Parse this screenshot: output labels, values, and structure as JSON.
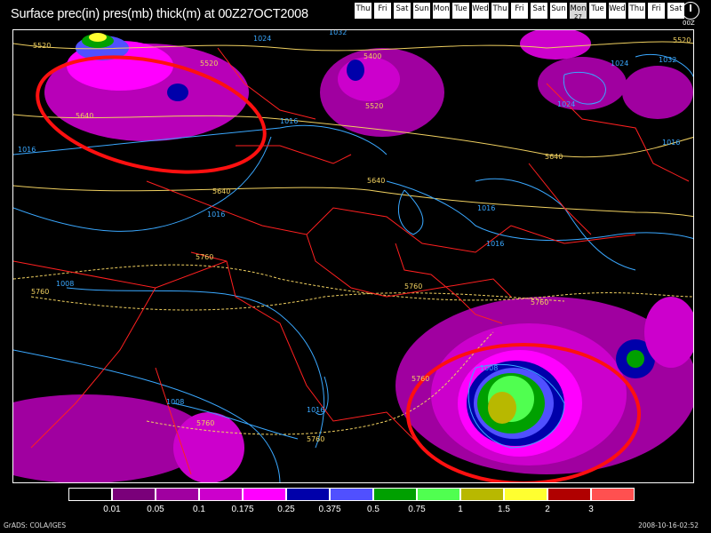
{
  "title": "Surface prec(in) pres(mb) thick(m) at 00Z27OCT2008",
  "days": [
    {
      "label": "Thu",
      "active": false
    },
    {
      "label": "Fri",
      "active": false
    },
    {
      "label": "Sat",
      "active": false
    },
    {
      "label": "Sun",
      "active": false
    },
    {
      "label": "Mon",
      "active": false
    },
    {
      "label": "Tue",
      "active": false
    },
    {
      "label": "Wed",
      "active": false
    },
    {
      "label": "Thu",
      "active": false
    },
    {
      "label": "Fri",
      "active": false
    },
    {
      "label": "Sat",
      "active": false
    },
    {
      "label": "Sun",
      "active": false
    },
    {
      "label": "Mon",
      "active": true,
      "date": "27"
    },
    {
      "label": "Tue",
      "active": false
    },
    {
      "label": "Wed",
      "active": false
    },
    {
      "label": "Thu",
      "active": false
    },
    {
      "label": "Fri",
      "active": false
    },
    {
      "label": "Sat",
      "active": false
    }
  ],
  "clock_label": "00Z",
  "colorbar": {
    "colors": [
      "#000000",
      "#7a007a",
      "#a000a0",
      "#cc00cc",
      "#ff00ff",
      "#0000aa",
      "#5050ff",
      "#00a000",
      "#50ff50",
      "#b8b800",
      "#ffff30",
      "#b00000",
      "#ff5050"
    ],
    "labels": [
      "0.01",
      "0.05",
      "0.1",
      "0.175",
      "0.25",
      "0.375",
      "0.5",
      "0.75",
      "1",
      "1.5",
      "2",
      "3"
    ]
  },
  "footer": {
    "left": "GrADS: COLA/IGES",
    "right": "2008-10-16-02:52"
  },
  "contour_labels": {
    "pressure": [
      "1024",
      "1032",
      "1016",
      "1016",
      "1016",
      "1016",
      "1016",
      "1016",
      "1024",
      "1032",
      "1024",
      "1008",
      "1008",
      "1008",
      "1016"
    ],
    "thickness": [
      "5520",
      "5520",
      "5400",
      "5520",
      "5520",
      "5640",
      "5640",
      "5640",
      "5640",
      "5760",
      "5760",
      "5760",
      "5760",
      "5760",
      "5760",
      "5760"
    ]
  },
  "colors": {
    "pressure_contour": "#3aa8ff",
    "thickness_contour": "#f0d060",
    "borders": "#ff2020",
    "highlight_circle": "#ff1010"
  }
}
